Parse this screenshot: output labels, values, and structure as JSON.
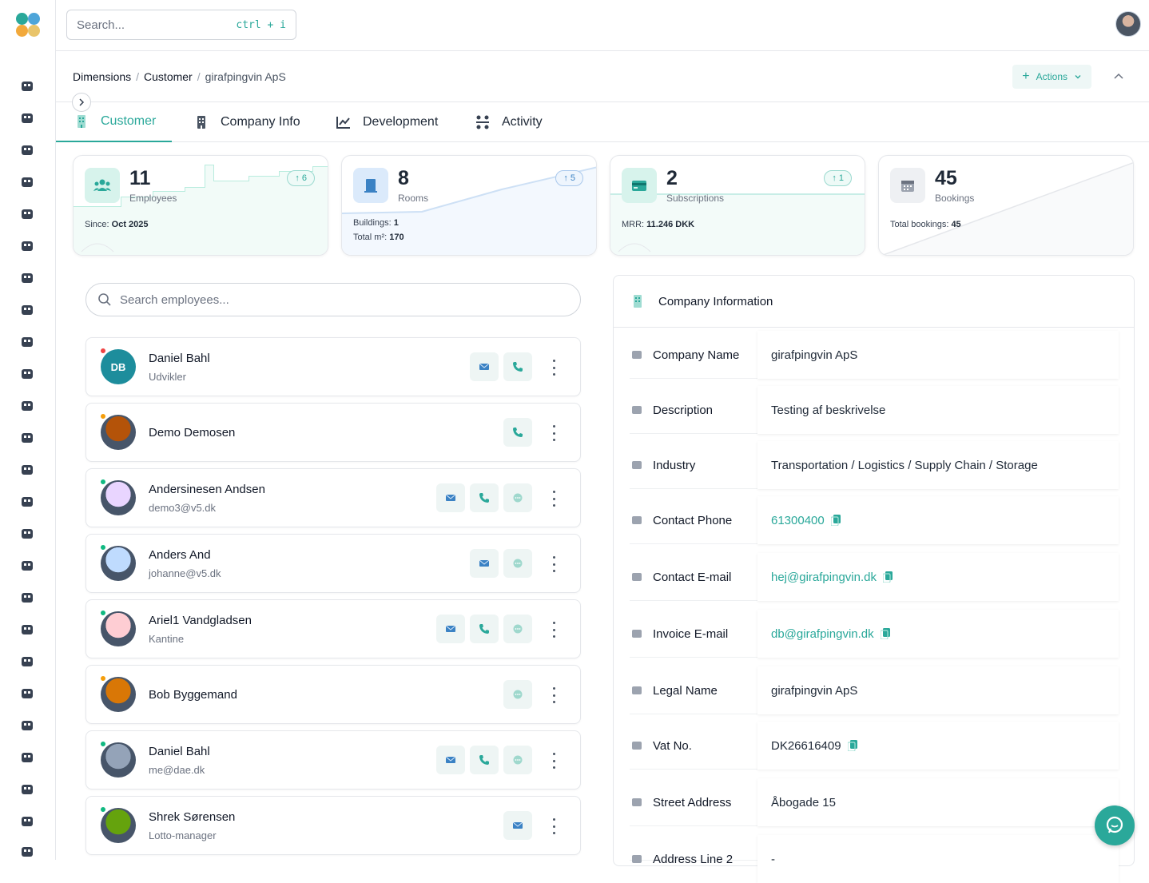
{
  "search": {
    "placeholder": "Search...",
    "shortcut": "ctrl + i"
  },
  "breadcrumb": [
    "Dimensions",
    "Customer",
    "girafpingvin ApS"
  ],
  "actions_label": "Actions",
  "tabs": [
    {
      "label": "Customer",
      "icon": "building-icon",
      "active": true
    },
    {
      "label": "Company Info",
      "icon": "office-icon",
      "active": false
    },
    {
      "label": "Development",
      "icon": "line-chart-icon",
      "active": false
    },
    {
      "label": "Activity",
      "icon": "activity-icon",
      "active": false
    }
  ],
  "stats": [
    {
      "value": "11",
      "label": "Employees",
      "badge": "6",
      "meta": [
        {
          "k": "Since: ",
          "v": "Oct 2025"
        }
      ],
      "icon": "users-icon"
    },
    {
      "value": "8",
      "label": "Rooms",
      "badge": "5",
      "meta": [
        {
          "k": "Buildings: ",
          "v": "1"
        },
        {
          "k": "Total m²: ",
          "v": "170"
        }
      ],
      "icon": "door-icon"
    },
    {
      "value": "2",
      "label": "Subscriptions",
      "badge": "1",
      "meta": [
        {
          "k": "MRR: ",
          "v": "11.246 DKK"
        }
      ],
      "icon": "credit-card-icon"
    },
    {
      "value": "45",
      "label": "Bookings",
      "badge": "",
      "meta": [
        {
          "k": "Total bookings: ",
          "v": "45"
        }
      ],
      "icon": "calendar-icon"
    }
  ],
  "employee_search_placeholder": "Search employees...",
  "employees": [
    {
      "name": "Daniel Bahl",
      "sub": "Udvikler",
      "initials": "DB",
      "status": "#ef4444",
      "actions": [
        "mail",
        "phone"
      ]
    },
    {
      "name": "Demo Demosen",
      "sub": "",
      "initials": "",
      "status": "#f59e0b",
      "actions": [
        "phone"
      ]
    },
    {
      "name": "Andersinesen Andsen",
      "sub": "demo3@v5.dk",
      "initials": "",
      "status": "#10b981",
      "actions": [
        "mail",
        "phone",
        "chat"
      ]
    },
    {
      "name": "Anders And",
      "sub": "johanne@v5.dk",
      "initials": "",
      "status": "#10b981",
      "actions": [
        "mail",
        "chat"
      ]
    },
    {
      "name": "Ariel1 Vandgladsen",
      "sub": "Kantine",
      "initials": "",
      "status": "#10b981",
      "actions": [
        "mail",
        "phone",
        "chat"
      ]
    },
    {
      "name": "Bob Byggemand",
      "sub": "",
      "initials": "",
      "status": "#f59e0b",
      "actions": [
        "chat"
      ]
    },
    {
      "name": "Daniel Bahl",
      "sub": "me@dae.dk",
      "initials": "",
      "status": "#10b981",
      "actions": [
        "mail",
        "phone",
        "chat"
      ]
    },
    {
      "name": "Shrek Sørensen",
      "sub": "Lotto-manager",
      "initials": "",
      "status": "#10b981",
      "actions": [
        "mail"
      ]
    }
  ],
  "company_info": {
    "title": "Company Information",
    "rows": [
      {
        "label": "Company Name",
        "value": "girafpingvin ApS",
        "link": false,
        "copy": false,
        "icon": "building-icon"
      },
      {
        "label": "Description",
        "value": "Testing af beskrivelse",
        "link": false,
        "copy": false,
        "icon": "text-lines-icon"
      },
      {
        "label": "Industry",
        "value": "Transportation / Logistics / Supply Chain / Storage",
        "link": false,
        "copy": false,
        "icon": "briefcase-icon"
      },
      {
        "label": "Contact Phone",
        "value": "61300400",
        "link": true,
        "copy": true,
        "icon": "phone-icon"
      },
      {
        "label": "Contact E-mail",
        "value": "hej@girafpingvin.dk",
        "link": true,
        "copy": true,
        "icon": "mail-icon"
      },
      {
        "label": "Invoice E-mail",
        "value": "db@girafpingvin.dk",
        "link": true,
        "copy": true,
        "icon": "invoice-icon"
      },
      {
        "label": "Legal Name",
        "value": "girafpingvin ApS",
        "link": false,
        "copy": false,
        "icon": "scale-icon"
      },
      {
        "label": "Vat No.",
        "value": "DK26616409",
        "link": false,
        "copy": true,
        "icon": "receipt-icon"
      },
      {
        "label": "Street Address",
        "value": "Åbogade 15",
        "link": false,
        "copy": false,
        "icon": "map-pin-icon"
      },
      {
        "label": "Address Line 2",
        "value": "-",
        "link": false,
        "copy": false,
        "icon": "location-icon"
      }
    ]
  },
  "sidebar_icons": [
    "helicopter-icon",
    "users-icon",
    "connections-icon",
    "robot-icon",
    "building-icon",
    "buildings-icon",
    "people-icon",
    "user-settings-icon",
    "truck-icon",
    "calendar-icon",
    "grid-icon",
    "hand-icon",
    "office-icon",
    "desk-icon",
    "map-icon",
    "globe-icon",
    "layers-icon",
    "dots-grid-icon",
    "boxes-icon",
    "list-icon",
    "puzzle-icon",
    "user-gear-icon",
    "group-icon",
    "checklist-icon",
    "printer-icon"
  ],
  "colors": {
    "accent": "#2aa89a",
    "blue": "#3b82c4"
  }
}
